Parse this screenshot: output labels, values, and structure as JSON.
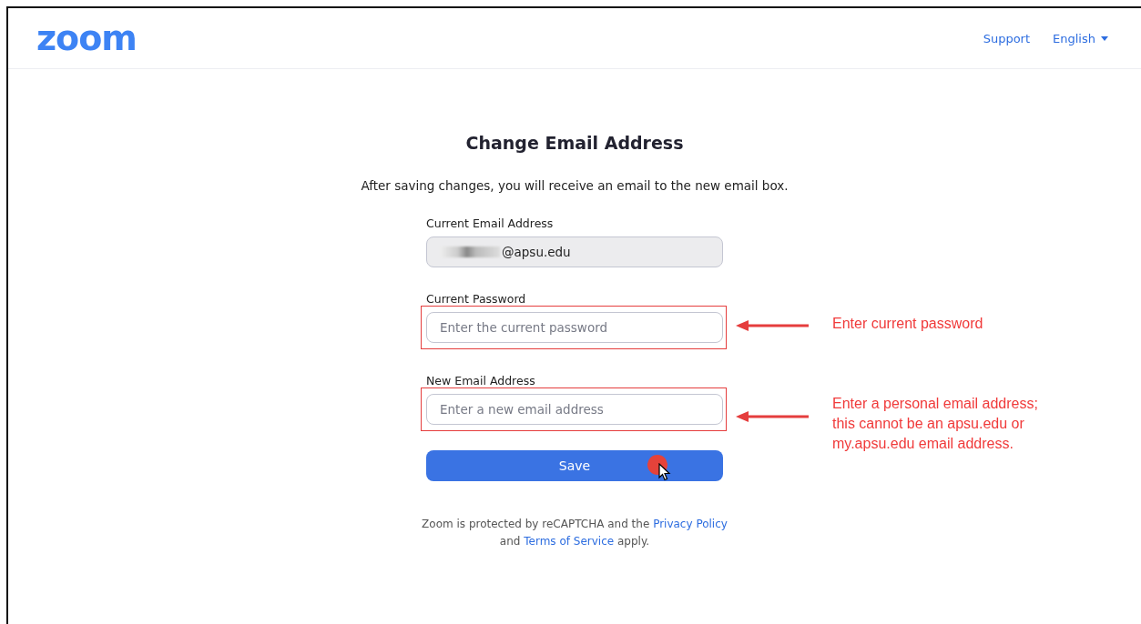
{
  "header": {
    "logo": "zoom",
    "links": [
      {
        "label": "Support",
        "kind": "link"
      },
      {
        "label": "English",
        "kind": "dropdown"
      }
    ]
  },
  "title": "Change Email Address",
  "subtitle": "After saving changes, you will receive an email to the new email box.",
  "fields": [
    {
      "label": "Current Email Address",
      "value": "@apsu.edu",
      "disabled": true,
      "redacted": true
    },
    {
      "label": "Current Password",
      "placeholder": "Enter the current password",
      "disabled": false,
      "annotation": {
        "lines": [
          "Enter current password"
        ]
      }
    },
    {
      "label": "New Email Address",
      "placeholder": "Enter a new email address",
      "disabled": false,
      "annotation": {
        "lines": [
          "Enter a personal email address;",
          "this cannot be an apsu.edu or",
          "my.apsu.edu email address."
        ]
      }
    }
  ],
  "save_button": "Save",
  "footer": {
    "before": "Zoom is protected by reCAPTCHA and the",
    "link1": "Privacy Policy",
    "middle": "and",
    "link2": "Terms of Service",
    "after": "apply."
  }
}
